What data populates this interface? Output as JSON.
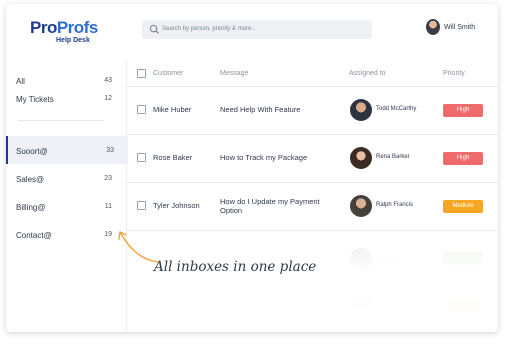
{
  "header": {
    "logo_brand_a": "Pro",
    "logo_brand_b": "Profs",
    "logo_sub": "Help Desk",
    "search_placeholder": "Search by person, priority & more..",
    "user_name": "Will Smith"
  },
  "sidebar": {
    "top_items": [
      {
        "label": "All",
        "count": "43"
      },
      {
        "label": "My Tickets",
        "count": "12"
      }
    ],
    "inboxes": [
      {
        "label": "Suoort@",
        "count": "33"
      },
      {
        "label": "Sales@",
        "count": "23"
      },
      {
        "label": "Billing@",
        "count": "11"
      },
      {
        "label": "Contact@",
        "count": "19"
      }
    ]
  },
  "table": {
    "columns": [
      "Customer",
      "Message",
      "Assigned to",
      "Priority"
    ],
    "rows": [
      {
        "customer": "Mike Huber",
        "message": "Need Help With Feature",
        "agent": "Todd McCarthy",
        "priority": "High"
      },
      {
        "customer": "Rose Baker",
        "message": "How to Track my Package",
        "agent": "Rena Barker",
        "priority": "High"
      },
      {
        "customer": "Tyler Johnson",
        "message": "How do I Update my Payment Option",
        "agent": "Ralph Francis",
        "priority": "Medium"
      }
    ]
  },
  "annotation": "All inboxes in one place",
  "colors": {
    "high": "#ef6b6b",
    "medium": "#f5a623",
    "brand_dark": "#1f3a8c",
    "brand_light": "#2b6fd6",
    "arrow": "#f0a33a"
  }
}
